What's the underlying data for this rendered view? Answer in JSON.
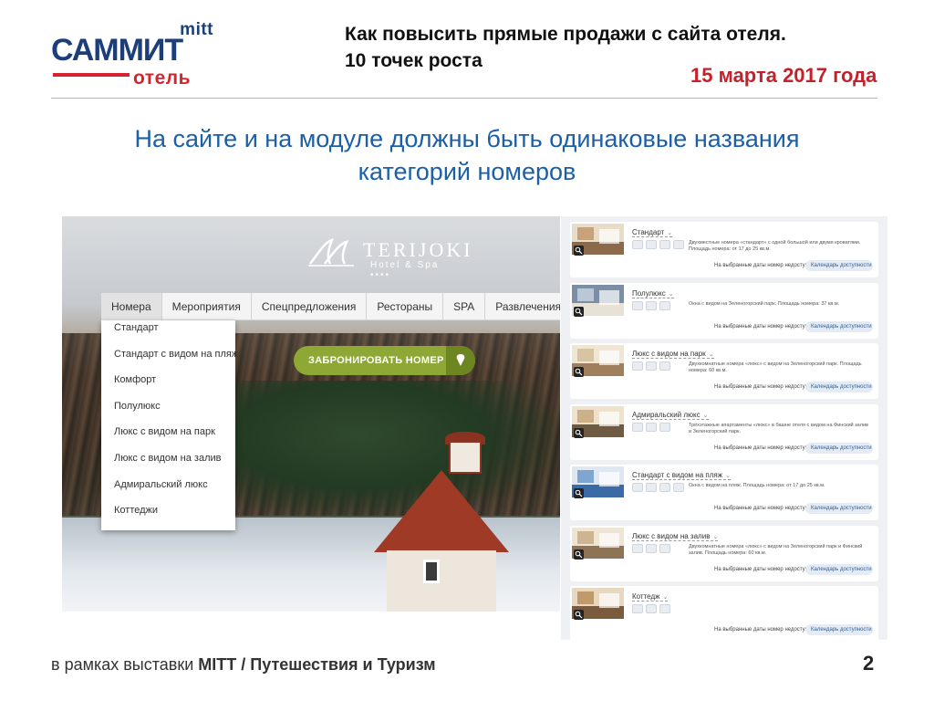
{
  "header": {
    "logo": {
      "line1": "mitt",
      "line2": "САММИТ",
      "line3": "отель"
    },
    "title_line1": "Как повысить прямые продажи с сайта отеля.",
    "title_line2": "10 точек роста",
    "date": "15 марта 2017 года"
  },
  "headline": {
    "line1": "На сайте и на модуле должны быть одинаковые названия",
    "line2": "категорий номеров"
  },
  "site": {
    "brand_name": "TERIJOKI",
    "brand_sub": "Hotel & Spa ••••",
    "nav": [
      "Номера",
      "Мероприятия",
      "Спецпредложения",
      "Рестораны",
      "SPA",
      "Развлечения",
      "Г"
    ],
    "dropdown": [
      "Стандарт",
      "Стандарт с видом на пляж",
      "Комфорт",
      "Полулюкс",
      "Люкс с видом на парк",
      "Люкс с видом на залив",
      "Адмиральский люкс",
      "Коттеджи"
    ],
    "book_button": "ЗАБРОНИРОВАТЬ НОМЕР"
  },
  "module": {
    "availability_text": "На выбранные даты номер недоступен",
    "calendar_label": "Календарь доступности",
    "rooms": [
      {
        "name": "Стандарт",
        "desc": "Двухместные номера «стандарт» с одной большой или двумя кроватями. Площадь номера: от 17 до 25 кв.м."
      },
      {
        "name": "Полулюкс",
        "desc": "Окна с видом на Зеленогорский парк. Площадь номера: 37 кв.м."
      },
      {
        "name": "Люкс с видом на парк",
        "desc": "Двухкомнатные номера «люкс» с видом на Зеленогорский парк. Площадь номера: 60 кв.м."
      },
      {
        "name": "Адмиральский люкс",
        "desc": "Трёхэтажные апартаменты «люкс» в башне отеля с видом на Финский залив и Зеленогорский парк."
      },
      {
        "name": "Стандарт с видом на пляж",
        "desc": "Окна с видом на пляж. Площадь номера: от 17 до 25 кв.м."
      },
      {
        "name": "Люкс с видом на залив",
        "desc": "Двухкомнатные номера «люкс» с видом на Зеленогорский парк и Финский залив. Площадь номера: 60 кв.м."
      },
      {
        "name": "Коттедж",
        "desc": ""
      }
    ]
  },
  "footer": {
    "prefix": "в рамках выставки ",
    "event": "MITT / Путешествия и Туризм",
    "page": "2"
  },
  "colors": {
    "headline_blue": "#1b5fa8",
    "date_red": "#c3222b",
    "logo_blue": "#1c3f7a",
    "logo_red": "#d6242f",
    "book_green": "#8da834"
  }
}
